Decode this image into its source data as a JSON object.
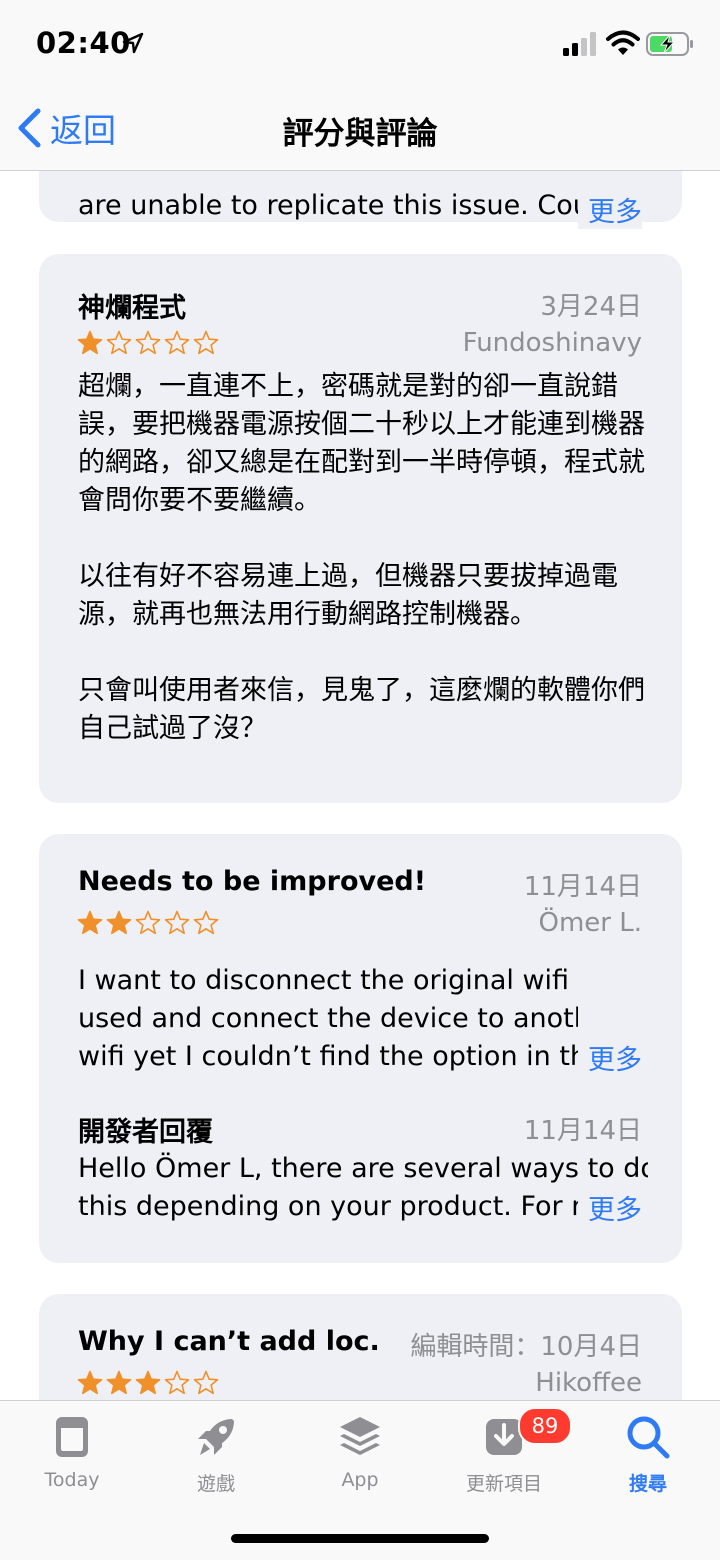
{
  "status": {
    "time": "02:40"
  },
  "nav": {
    "back_label": "返回",
    "title": "評分與評論"
  },
  "prev_review": {
    "text": "are unable to replicate this issue. Cou",
    "more": "更多"
  },
  "reviews": [
    {
      "title": "神爛程式",
      "date": "3月24日",
      "author": "Fundoshinavy",
      "rating": 1,
      "body": [
        "超爛，一直連不上，密碼就是對的卻一直說錯誤，要把機器電源按個二十秒以上才能連到機器的網路，卻又總是在配對到一半時停頓，程式就會問你要不要繼續。",
        "以往有好不容易連上過，但機器只要拔掉過電源，就再也無法用行動網路控制機器。",
        "只會叫使用者來信，見鬼了，這麼爛的軟體你們自己試過了沒？"
      ]
    },
    {
      "title": "Needs to be improved!",
      "date": "11月14日",
      "author": "Ömer L.",
      "rating": 2,
      "body_lines": [
        "I want to disconnect the original wifi that I",
        "used and connect the device to another",
        "wifi yet I couldn’t find the option in the"
      ],
      "more": "更多",
      "developer_response": {
        "title": "開發者回覆",
        "date": "11月14日",
        "lines": [
          "Hello Ömer L, there are several ways to do",
          "this depending on your product. For more"
        ],
        "more": "更多"
      }
    },
    {
      "title": "Why I can’t add loc...",
      "date": "編輯時間：10月4日",
      "author": "Hikoffee",
      "rating": 3
    }
  ],
  "tabs": [
    {
      "label": "Today",
      "icon": "today-icon",
      "active": false
    },
    {
      "label": "遊戲",
      "icon": "rocket-icon",
      "active": false
    },
    {
      "label": "App",
      "icon": "layers-icon",
      "active": false
    },
    {
      "label": "更新項目",
      "icon": "download-icon",
      "badge": "89",
      "active": false
    },
    {
      "label": "搜尋",
      "icon": "search-icon",
      "active": true
    }
  ],
  "colors": {
    "accent": "#2f7bf5",
    "star": "#f0902a",
    "card": "#eff0f5",
    "badge": "#ff3b30"
  }
}
